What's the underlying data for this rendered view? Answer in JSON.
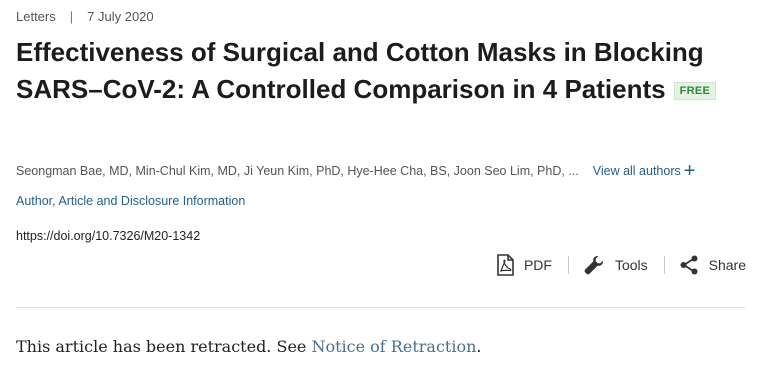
{
  "article": {
    "type": "Letters",
    "separator": "|",
    "date": "7 July 2020",
    "title": "Effectiveness of Surgical and Cotton Masks in Blocking SARS–CoV-2: A Controlled Comparison in 4 Patients",
    "free_badge": "FREE",
    "authors": "Seongman Bae, MD, Min-Chul Kim, MD, Ji Yeun Kim, PhD, Hye-Hee Cha, BS, Joon Seo Lim, PhD, ...",
    "view_all_authors": "View all authors",
    "view_all_icon": "plus-icon",
    "disclosure_link": "Author, Article and Disclosure Information",
    "doi": "https://doi.org/10.7326/M20-1342"
  },
  "toolbar": {
    "pdf": {
      "label": "PDF",
      "icon": "pdf-icon"
    },
    "tools": {
      "label": "Tools",
      "icon": "wrench-icon"
    },
    "share": {
      "label": "Share",
      "icon": "share-icon"
    }
  },
  "notice": {
    "text_before": "This article has been retracted. See ",
    "link": "Notice of Retraction",
    "text_after": "."
  },
  "colors": {
    "link": "#1f5f8a",
    "free_badge_text": "#2f8a3a",
    "free_badge_bg": "#e6f2e6",
    "notice_link": "#4a6f8e"
  }
}
